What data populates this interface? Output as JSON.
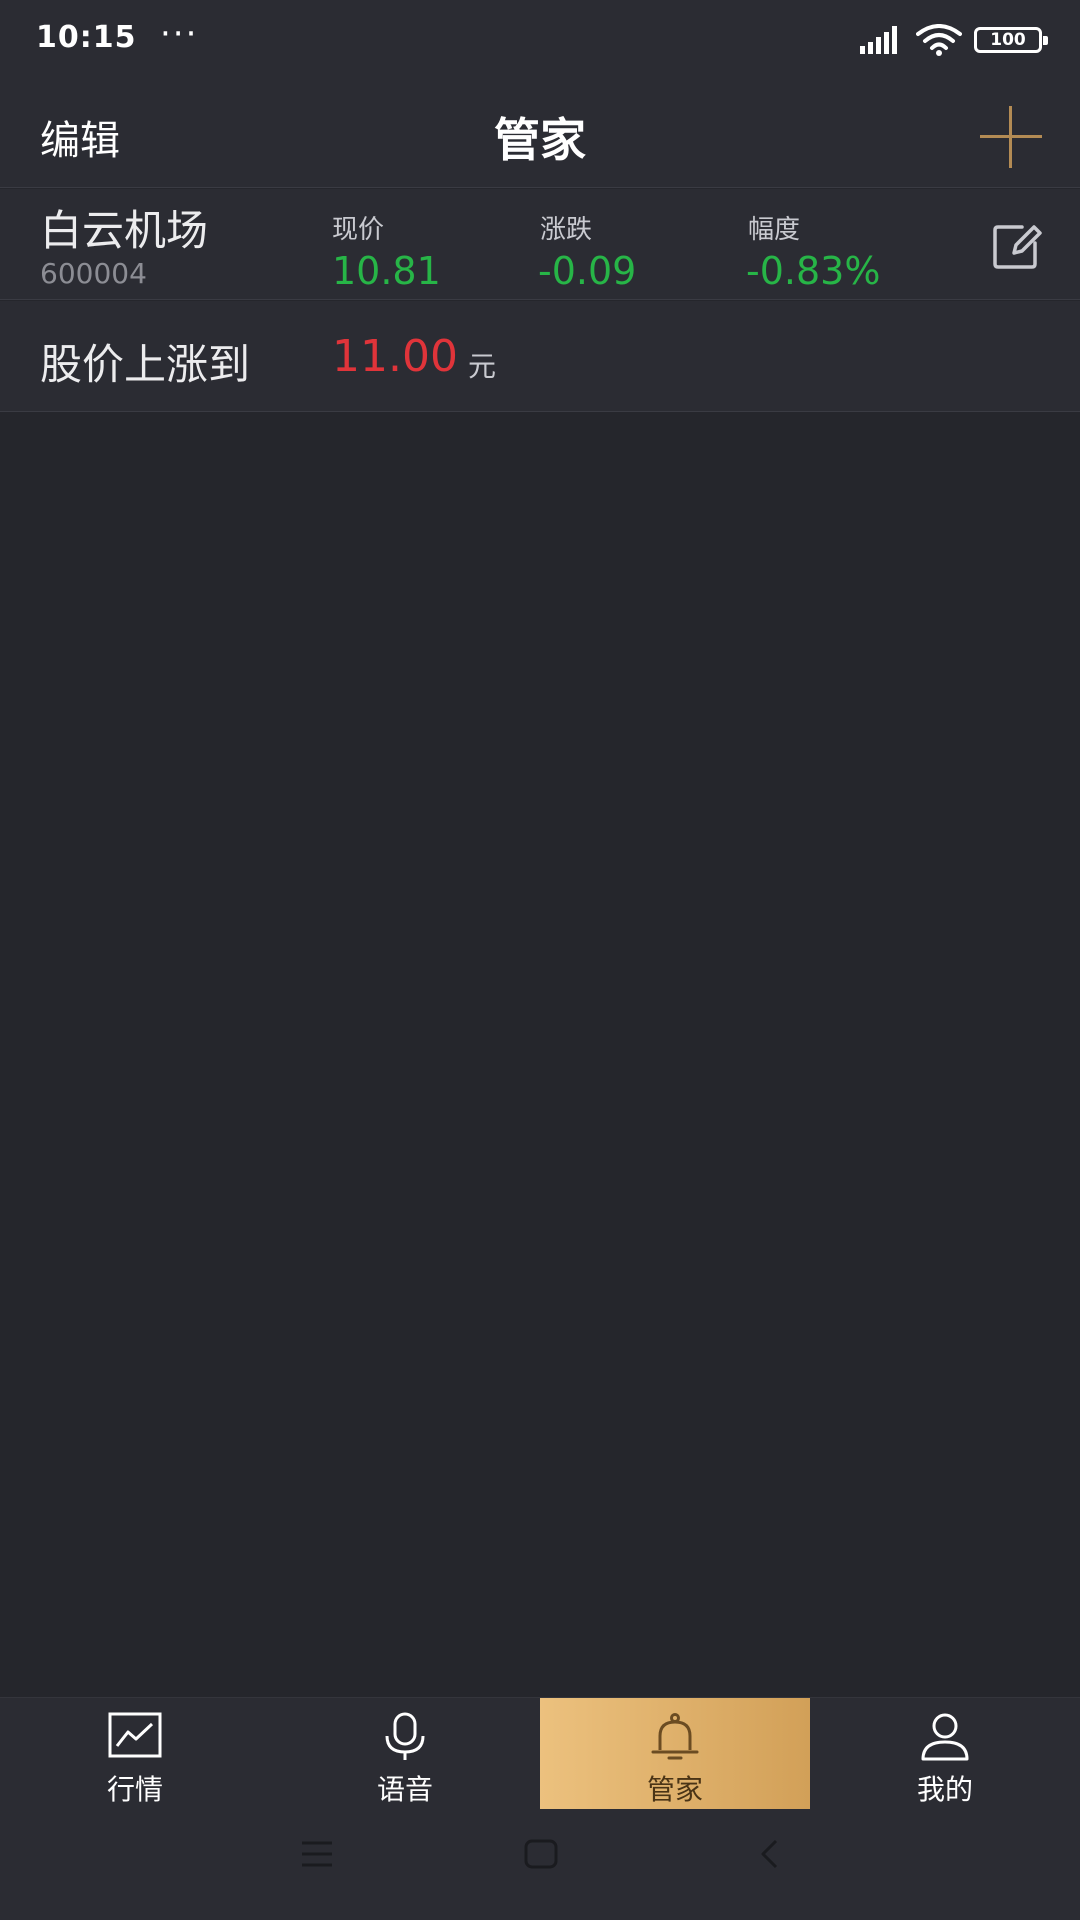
{
  "status_bar": {
    "time": "10:15",
    "dots": "···",
    "battery": "100"
  },
  "nav": {
    "edit_label": "编辑",
    "title": "管家",
    "add_icon": "plus-icon",
    "accent_color": "#b38b54"
  },
  "stock": {
    "name": "白云机场",
    "code": "600004",
    "columns": [
      {
        "label": "现价",
        "value": "10.81"
      },
      {
        "label": "涨跌",
        "value": "-0.09"
      },
      {
        "label": "幅度",
        "value": "-0.83%"
      }
    ],
    "value_color": "#27b547",
    "edit_icon": "edit-icon"
  },
  "alert": {
    "label": "股价上涨到",
    "value": "11.00",
    "unit": "元",
    "value_color": "#e0343a"
  },
  "tabs": [
    {
      "label": "行情",
      "icon": "chart-icon",
      "active": false
    },
    {
      "label": "语音",
      "icon": "microphone-icon",
      "active": false
    },
    {
      "label": "管家",
      "icon": "bell-icon",
      "active": true
    },
    {
      "label": "我的",
      "icon": "user-icon",
      "active": false
    }
  ],
  "system_nav": [
    "menu-icon",
    "home-icon",
    "back-icon"
  ]
}
